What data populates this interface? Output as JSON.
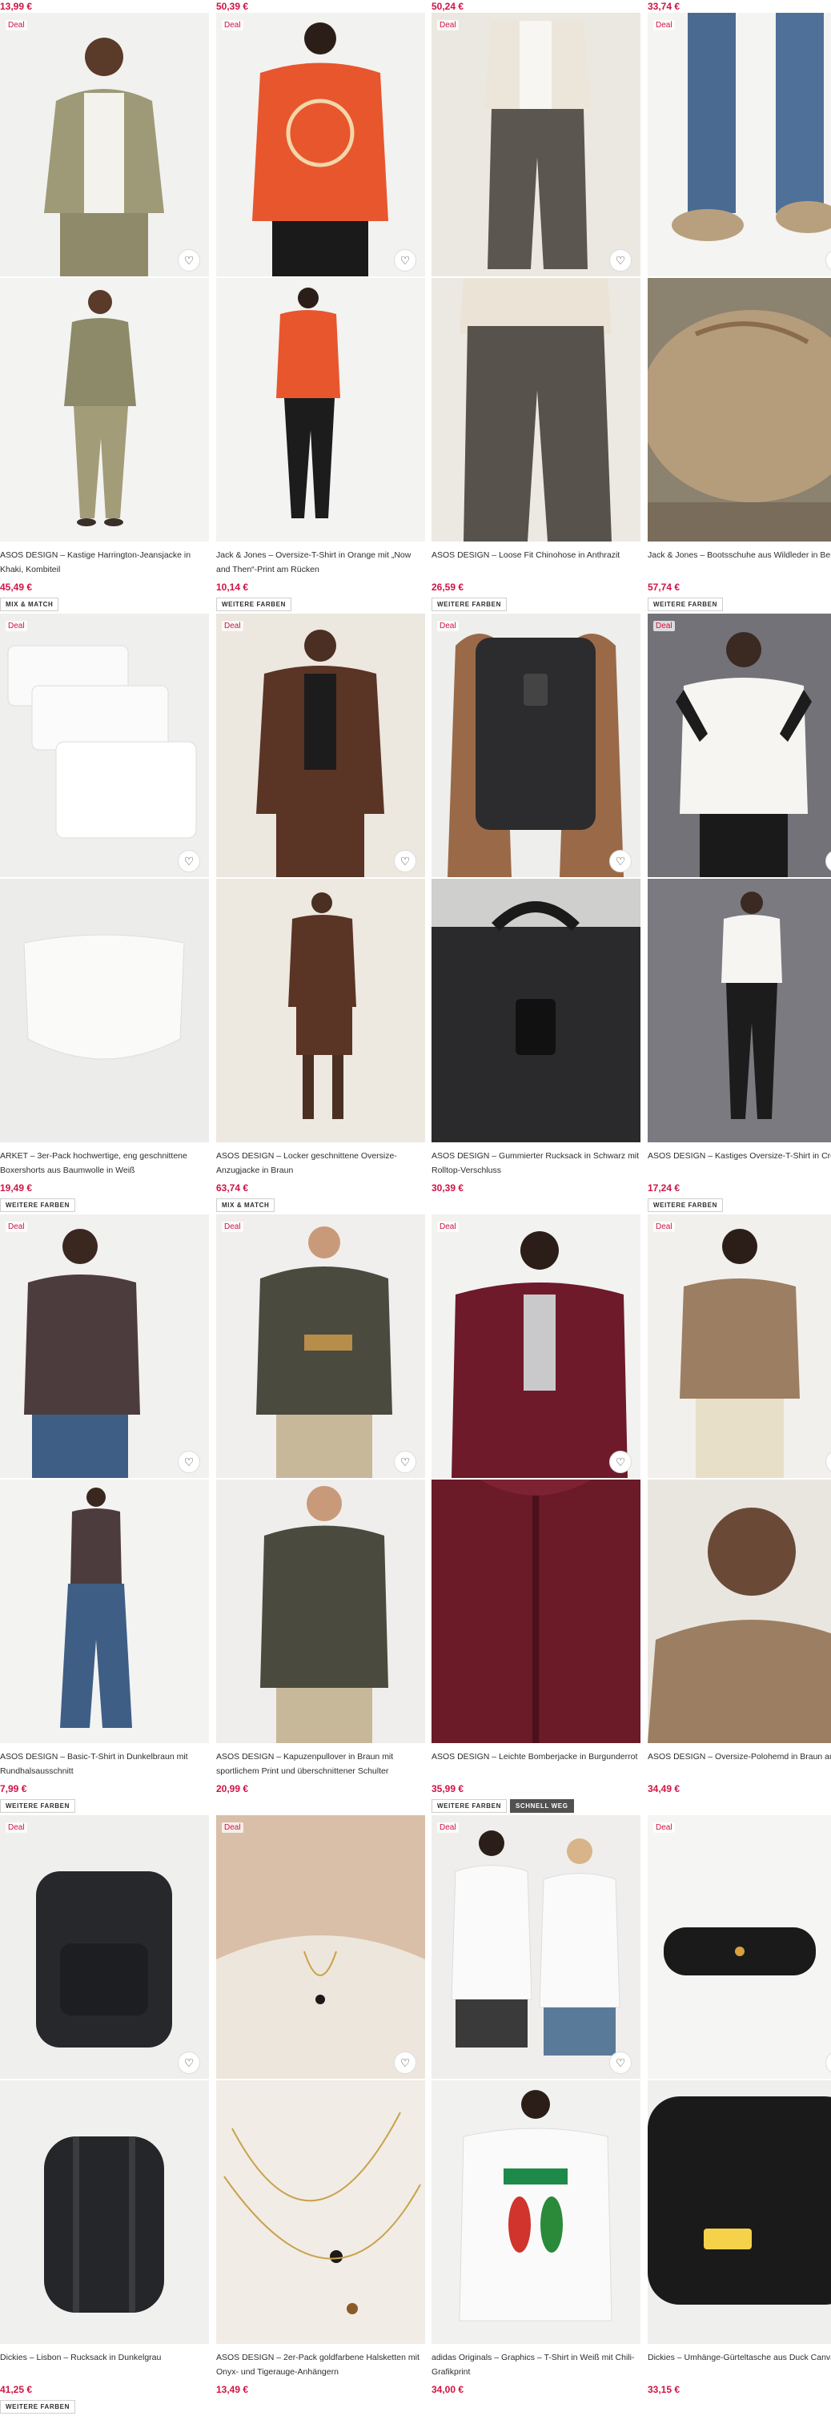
{
  "top_prices": [
    "13,99 €",
    "50,39 €",
    "50,24 €",
    "33,74 €"
  ],
  "deal_label": "Deal",
  "products": [
    {
      "title": "ASOS DESIGN – Kastige Harrington-Jeansjacke in Khaki, Kombiteil",
      "price": "45,49 €",
      "badges": [
        "MIX & MATCH"
      ],
      "deal": true
    },
    {
      "title": "Jack & Jones – Oversize-T-Shirt in Orange mit „Now and Then“-Print am Rücken",
      "price": "10,14 €",
      "badges": [
        "WEITERE FARBEN"
      ],
      "deal": true
    },
    {
      "title": "ASOS DESIGN – Loose Fit Chinohose in Anthrazit",
      "price": "26,59 €",
      "badges": [
        "WEITERE FARBEN"
      ],
      "deal": true
    },
    {
      "title": "Jack & Jones – Bootsschuhe aus Wildleder in Beige",
      "price": "57,74 €",
      "badges": [
        "WEITERE FARBEN"
      ],
      "deal": true
    },
    {
      "title": "ARKET – 3er-Pack hochwertige, eng geschnittene Boxershorts aus Baumwolle in Weiß",
      "price": "19,49 €",
      "badges": [
        "WEITERE FARBEN"
      ],
      "deal": true
    },
    {
      "title": "ASOS DESIGN – Locker geschnittene Oversize-Anzugjacke in Braun",
      "price": "63,74 €",
      "badges": [
        "MIX & MATCH"
      ],
      "deal": true
    },
    {
      "title": "ASOS DESIGN – Gummierter Rucksack in Schwarz mit Rolltop-Verschluss",
      "price": "30,39 €",
      "badges": [],
      "deal": true
    },
    {
      "title": "ASOS DESIGN – Kastiges Oversize-T-Shirt in Cremeweiß mit Einsätzen",
      "price": "17,24 €",
      "badges": [
        "WEITERE FARBEN"
      ],
      "deal": true
    },
    {
      "title": "ASOS DESIGN – Basic-T-Shirt in Dunkelbraun mit Rundhalsausschnitt",
      "price": "7,99 €",
      "badges": [
        "WEITERE FARBEN"
      ],
      "deal": true
    },
    {
      "title": "ASOS DESIGN – Kapuzenpullover in Braun mit sportlichem Print und überschnittener Schulter",
      "price": "20,99 €",
      "badges": [],
      "deal": true
    },
    {
      "title": "ASOS DESIGN – Leichte Bomberjacke in Burgunderrot",
      "price": "35,99 €",
      "badges": [
        "WEITERE FARBEN",
        "SCHNELL WEG"
      ],
      "deal": true
    },
    {
      "title": "ASOS DESIGN – Oversize-Polohemd in Braun aus Strick mit Langettenstich",
      "price": "34,49 €",
      "badges": [],
      "deal": true
    },
    {
      "title": "Dickies – Lisbon – Rucksack in Dunkelgrau",
      "price": "41,25 €",
      "badges": [
        "WEITERE FARBEN"
      ],
      "deal": true
    },
    {
      "title": "ASOS DESIGN – 2er-Pack goldfarbene Halsketten mit Onyx- und Tigerauge-Anhängern",
      "price": "13,49 €",
      "badges": [],
      "deal": true
    },
    {
      "title": "adidas Originals – Graphics – T-Shirt in Weiß mit Chili-Grafikprint",
      "price": "34,00 €",
      "badges": [],
      "deal": true
    },
    {
      "title": "Dickies – Umhänge-Gürteltasche aus Duck Canvas in Schwarz",
      "price": "33,15 €",
      "badges": [],
      "deal": true
    }
  ],
  "icons": {
    "wishlist": "heart-icon"
  },
  "colors": {
    "price": "#d01345",
    "text": "#2d2d2d",
    "badge_dark": "#525050"
  }
}
